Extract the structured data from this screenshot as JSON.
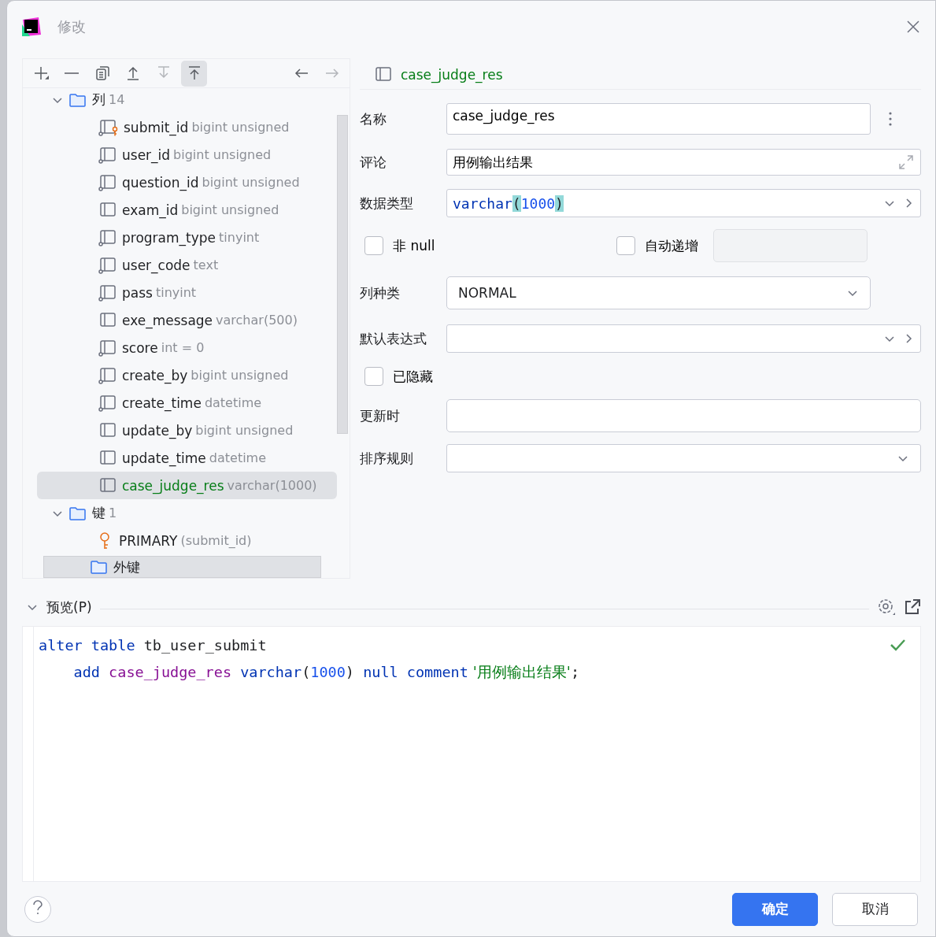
{
  "window": {
    "title": "修改"
  },
  "toolbar": [
    {
      "kind": "add",
      "disabled": false,
      "selected": false
    },
    {
      "kind": "remove",
      "disabled": false,
      "selected": false
    },
    {
      "kind": "copy",
      "disabled": false,
      "selected": false
    },
    {
      "kind": "up",
      "disabled": false,
      "selected": false
    },
    {
      "kind": "down",
      "disabled": true,
      "selected": false
    },
    {
      "kind": "top",
      "disabled": false,
      "selected": true
    },
    {
      "kind": "back",
      "disabled": false,
      "selected": false
    },
    {
      "kind": "forward",
      "disabled": true,
      "selected": false
    }
  ],
  "tree": [
    {
      "label": "列",
      "count": "14",
      "expanded": true,
      "children": [
        {
          "name": "submit_id",
          "detail": "bigint unsigned",
          "kind": "key-column",
          "selected": false,
          "modified": false
        },
        {
          "name": "user_id",
          "detail": "bigint unsigned",
          "kind": "dot-column",
          "selected": false,
          "modified": false
        },
        {
          "name": "question_id",
          "detail": "bigint unsigned",
          "kind": "dot-column",
          "selected": false,
          "modified": false
        },
        {
          "name": "exam_id",
          "detail": "bigint unsigned",
          "kind": "column",
          "selected": false,
          "modified": false
        },
        {
          "name": "program_type",
          "detail": "tinyint",
          "kind": "dot-column",
          "selected": false,
          "modified": false
        },
        {
          "name": "user_code",
          "detail": "text",
          "kind": "dot-column",
          "selected": false,
          "modified": false
        },
        {
          "name": "pass",
          "detail": "tinyint",
          "kind": "dot-column",
          "selected": false,
          "modified": false
        },
        {
          "name": "exe_message",
          "detail": "varchar(500)",
          "kind": "column",
          "selected": false,
          "modified": false
        },
        {
          "name": "score",
          "detail": "int = 0",
          "kind": "dot-column",
          "selected": false,
          "modified": false
        },
        {
          "name": "create_by",
          "detail": "bigint unsigned",
          "kind": "dot-column",
          "selected": false,
          "modified": false
        },
        {
          "name": "create_time",
          "detail": "datetime",
          "kind": "dot-column",
          "selected": false,
          "modified": false
        },
        {
          "name": "update_by",
          "detail": "bigint unsigned",
          "kind": "column",
          "selected": false,
          "modified": false
        },
        {
          "name": "update_time",
          "detail": "datetime",
          "kind": "column",
          "selected": false,
          "modified": false
        },
        {
          "name": "case_judge_res",
          "detail": "varchar(1000)",
          "kind": "column",
          "selected": true,
          "modified": true
        }
      ]
    },
    {
      "label": "键",
      "count": "1",
      "expanded": true,
      "children": [
        {
          "name": "PRIMARY",
          "detail": "(submit_id)",
          "kind": "key",
          "selected": false,
          "modified": false
        }
      ]
    },
    {
      "label": "外键"
    }
  ],
  "editor_header": {
    "title": "case_judge_res"
  },
  "form": [
    {
      "kind": "text",
      "label": "名称",
      "value": "case_judge_res",
      "menu": true
    },
    {
      "kind": "expand",
      "label": "评论",
      "value": "用例输出结果"
    },
    {
      "kind": "code",
      "label": "数据类型",
      "tokens": [
        {
          "text": "varchar",
          "kind": "keyword",
          "matched": false
        },
        {
          "text": "(",
          "kind": "bracket",
          "matched": true
        },
        {
          "text": "1000",
          "kind": "number",
          "matched": false
        },
        {
          "text": ")",
          "kind": "bracket",
          "matched": true
        }
      ]
    },
    {
      "kind": "checks",
      "items": [
        {
          "label": "非 null",
          "checked": false
        },
        {
          "label": "自动递增",
          "checked": false
        }
      ]
    },
    {
      "kind": "select",
      "label": "列种类",
      "value": "NORMAL"
    },
    {
      "kind": "combo",
      "label": "默认表达式"
    },
    {
      "kind": "check",
      "items": [
        {
          "label": "已隐藏",
          "checked": false
        }
      ]
    },
    {
      "kind": "text",
      "label": "更新时",
      "menu": false
    },
    {
      "kind": "select",
      "label": "排序规则",
      "wide": true
    }
  ],
  "preview": {
    "title": "预览(P)",
    "valid": true,
    "lines": [
      [
        {
          "text": "alter",
          "kind": "keyword"
        },
        {
          "text": " table",
          "kind": "keyword"
        },
        {
          "text": " tb_user_submit"
        }
      ],
      [
        {
          "text": "    add",
          "kind": "keyword"
        },
        {
          "text": " case_judge_res",
          "kind": "ident"
        },
        {
          "text": " varchar",
          "kind": "keyword"
        },
        {
          "text": "("
        },
        {
          "text": "1000",
          "kind": "number"
        },
        {
          "text": ") "
        },
        {
          "text": "null",
          "kind": "keyword"
        },
        {
          "text": " comment",
          "kind": "keyword"
        },
        {
          "text": " '用例输出结果'",
          "kind": "string"
        },
        {
          "text": ";"
        }
      ]
    ]
  },
  "buttons": [
    {
      "label": "确定",
      "primary": true
    },
    {
      "label": "取消",
      "primary": false
    }
  ]
}
